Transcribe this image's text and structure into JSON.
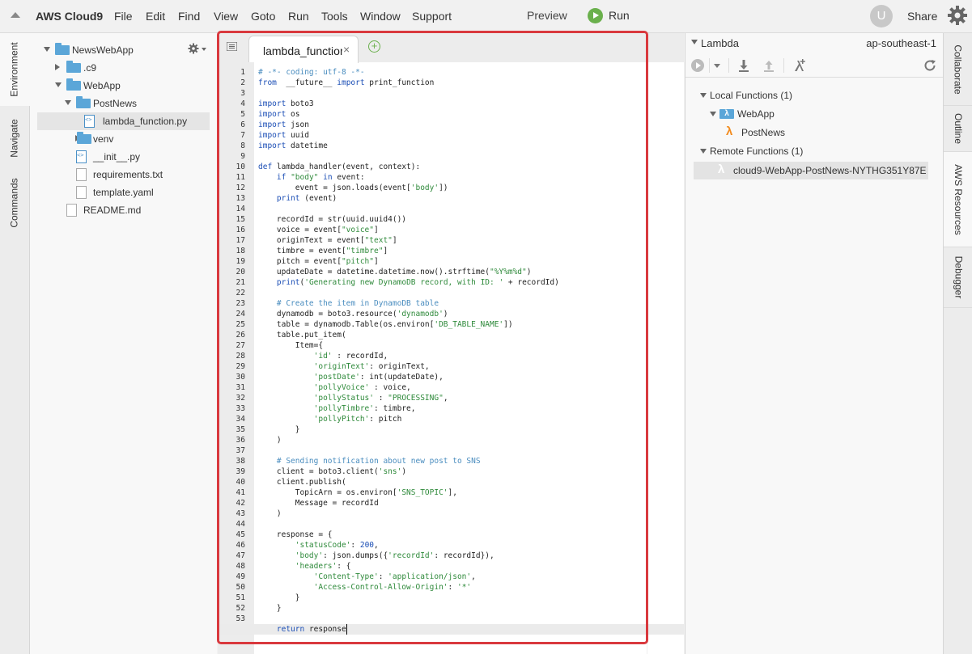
{
  "menubar": {
    "brand": "AWS Cloud9",
    "menus": [
      "File",
      "Edit",
      "Find",
      "View",
      "Goto",
      "Run",
      "Tools",
      "Window",
      "Support"
    ],
    "preview": "Preview",
    "run": "Run",
    "avatar_initial": "U",
    "share": "Share"
  },
  "left_tabs": [
    "Environment",
    "Navigate",
    "Commands"
  ],
  "tree": [
    {
      "label": "NewsWebApp",
      "type": "folder",
      "expanded": true,
      "depth": 0
    },
    {
      "label": ".c9",
      "type": "folder",
      "expanded": false,
      "depth": 1
    },
    {
      "label": "WebApp",
      "type": "folder",
      "expanded": true,
      "depth": 1
    },
    {
      "label": "PostNews",
      "type": "folder",
      "expanded": true,
      "depth": 2
    },
    {
      "label": "lambda_function.py",
      "type": "py",
      "selected": true,
      "depth": 3
    },
    {
      "label": "venv",
      "type": "folder",
      "expanded": false,
      "depth": 2
    },
    {
      "label": "__init__.py",
      "type": "py",
      "depth": 2
    },
    {
      "label": "requirements.txt",
      "type": "file",
      "depth": 2
    },
    {
      "label": "template.yaml",
      "type": "file",
      "depth": 2
    },
    {
      "label": "README.md",
      "type": "file",
      "depth": 1
    }
  ],
  "editor": {
    "tab_label": "lambda_function.py",
    "active_line": 54,
    "lines": [
      [
        [
          "cm",
          "# -*- coding: utf-8 -*-"
        ]
      ],
      [
        [
          "kw",
          "from"
        ],
        [
          "",
          "  __future__ "
        ],
        [
          "kw",
          "import"
        ],
        [
          "",
          " print_function"
        ]
      ],
      [
        [
          "",
          ""
        ]
      ],
      [
        [
          "kw",
          "import"
        ],
        [
          "",
          " boto3"
        ]
      ],
      [
        [
          "kw",
          "import"
        ],
        [
          "",
          " os"
        ]
      ],
      [
        [
          "kw",
          "import"
        ],
        [
          "",
          " json"
        ]
      ],
      [
        [
          "kw",
          "import"
        ],
        [
          "",
          " uuid"
        ]
      ],
      [
        [
          "kw",
          "import"
        ],
        [
          "",
          " datetime"
        ]
      ],
      [
        [
          "",
          ""
        ]
      ],
      [
        [
          "kw",
          "def"
        ],
        [
          "",
          " lambda_handler(event, context):"
        ]
      ],
      [
        [
          "",
          "    "
        ],
        [
          "kw",
          "if"
        ],
        [
          "",
          " "
        ],
        [
          "str",
          "\"body\""
        ],
        [
          "",
          " "
        ],
        [
          "kw",
          "in"
        ],
        [
          "",
          " event:"
        ]
      ],
      [
        [
          "",
          "        event = json.loads(event["
        ],
        [
          "str",
          "'body'"
        ],
        [
          "",
          "])"
        ]
      ],
      [
        [
          "",
          "    "
        ],
        [
          "builtin",
          "print"
        ],
        [
          "",
          " (event)"
        ]
      ],
      [
        [
          "",
          ""
        ]
      ],
      [
        [
          "",
          "    recordId = str(uuid.uuid4())"
        ]
      ],
      [
        [
          "",
          "    voice = event["
        ],
        [
          "str",
          "\"voice\""
        ],
        [
          "",
          "]"
        ]
      ],
      [
        [
          "",
          "    originText = event["
        ],
        [
          "str",
          "\"text\""
        ],
        [
          "",
          "]"
        ]
      ],
      [
        [
          "",
          "    timbre = event["
        ],
        [
          "str",
          "\"timbre\""
        ],
        [
          "",
          "]"
        ]
      ],
      [
        [
          "",
          "    pitch = event["
        ],
        [
          "str",
          "\"pitch\""
        ],
        [
          "",
          "]"
        ]
      ],
      [
        [
          "",
          "    updateDate = datetime.datetime.now().strftime("
        ],
        [
          "str",
          "\"%Y%m%d\""
        ],
        [
          "",
          ")"
        ]
      ],
      [
        [
          "",
          "    "
        ],
        [
          "builtin",
          "print"
        ],
        [
          "",
          "("
        ],
        [
          "str",
          "'Generating new DynamoDB record, with ID: '"
        ],
        [
          "",
          " + recordId)"
        ]
      ],
      [
        [
          "",
          ""
        ]
      ],
      [
        [
          "",
          "    "
        ],
        [
          "cm",
          "# Create the item in DynamoDB table"
        ]
      ],
      [
        [
          "",
          "    dynamodb = boto3.resource("
        ],
        [
          "str",
          "'dynamodb'"
        ],
        [
          "",
          ")"
        ]
      ],
      [
        [
          "",
          "    table = dynamodb.Table(os.environ["
        ],
        [
          "str",
          "'DB_TABLE_NAME'"
        ],
        [
          "",
          "])"
        ]
      ],
      [
        [
          "",
          "    table.put_item("
        ]
      ],
      [
        [
          "",
          "        Item={"
        ]
      ],
      [
        [
          "",
          "            "
        ],
        [
          "str",
          "'id'"
        ],
        [
          "",
          " : recordId,"
        ]
      ],
      [
        [
          "",
          "            "
        ],
        [
          "str",
          "'originText'"
        ],
        [
          "",
          ": originText,"
        ]
      ],
      [
        [
          "",
          "            "
        ],
        [
          "str",
          "'postDate'"
        ],
        [
          "",
          ": int(updateDate),"
        ]
      ],
      [
        [
          "",
          "            "
        ],
        [
          "str",
          "'pollyVoice'"
        ],
        [
          "",
          " : voice,"
        ]
      ],
      [
        [
          "",
          "            "
        ],
        [
          "str",
          "'pollyStatus'"
        ],
        [
          "",
          " : "
        ],
        [
          "str",
          "\"PROCESSING\""
        ],
        [
          "",
          ","
        ]
      ],
      [
        [
          "",
          "            "
        ],
        [
          "str",
          "'pollyTimbre'"
        ],
        [
          "",
          ": timbre,"
        ]
      ],
      [
        [
          "",
          "            "
        ],
        [
          "str",
          "'pollyPitch'"
        ],
        [
          "",
          ": pitch"
        ]
      ],
      [
        [
          "",
          "        }"
        ]
      ],
      [
        [
          "",
          "    )"
        ]
      ],
      [
        [
          "",
          ""
        ]
      ],
      [
        [
          "",
          "    "
        ],
        [
          "cm",
          "# Sending notification about new post to SNS"
        ]
      ],
      [
        [
          "",
          "    client = boto3.client("
        ],
        [
          "str",
          "'sns'"
        ],
        [
          "",
          ")"
        ]
      ],
      [
        [
          "",
          "    client.publish("
        ]
      ],
      [
        [
          "",
          "        TopicArn = os.environ["
        ],
        [
          "str",
          "'SNS_TOPIC'"
        ],
        [
          "",
          "],"
        ]
      ],
      [
        [
          "",
          "        Message = recordId"
        ]
      ],
      [
        [
          "",
          "    )"
        ]
      ],
      [
        [
          "",
          ""
        ]
      ],
      [
        [
          "",
          "    response = {"
        ]
      ],
      [
        [
          "",
          "        "
        ],
        [
          "str",
          "'statusCode'"
        ],
        [
          "",
          ": "
        ],
        [
          "kw",
          "200"
        ],
        [
          "",
          ","
        ]
      ],
      [
        [
          "",
          "        "
        ],
        [
          "str",
          "'body'"
        ],
        [
          "",
          ": json.dumps({"
        ],
        [
          "str",
          "'recordId'"
        ],
        [
          "",
          ": recordId}),"
        ]
      ],
      [
        [
          "",
          "        "
        ],
        [
          "str",
          "'headers'"
        ],
        [
          "",
          ": {"
        ]
      ],
      [
        [
          "",
          "            "
        ],
        [
          "str",
          "'Content-Type'"
        ],
        [
          "",
          ": "
        ],
        [
          "str",
          "'application/json'"
        ],
        [
          "",
          ","
        ]
      ],
      [
        [
          "",
          "            "
        ],
        [
          "str",
          "'Access-Control-Allow-Origin'"
        ],
        [
          "",
          ": "
        ],
        [
          "str",
          "'*'"
        ]
      ],
      [
        [
          "",
          "        }"
        ]
      ],
      [
        [
          "",
          "    }"
        ]
      ],
      [
        [
          "",
          ""
        ]
      ],
      [
        [
          "",
          "    "
        ],
        [
          "kw",
          "return"
        ],
        [
          "",
          " response"
        ]
      ]
    ]
  },
  "right_panel": {
    "title": "Lambda",
    "region": "ap-southeast-1",
    "local_functions": "Local Functions (1)",
    "local_app": "WebApp",
    "local_fn": "PostNews",
    "remote_functions": "Remote Functions (1)",
    "remote_fn": "cloud9-WebApp-PostNews-NYTHG351Y87E"
  },
  "right_tabs": [
    "Collaborate",
    "Outline",
    "AWS Resources",
    "Debugger"
  ],
  "colors": {
    "highlight": "#d9393e",
    "run_green": "#6ab04c",
    "lambda_orange": "#f28b1e",
    "folder_blue": "#5ba6d8"
  }
}
